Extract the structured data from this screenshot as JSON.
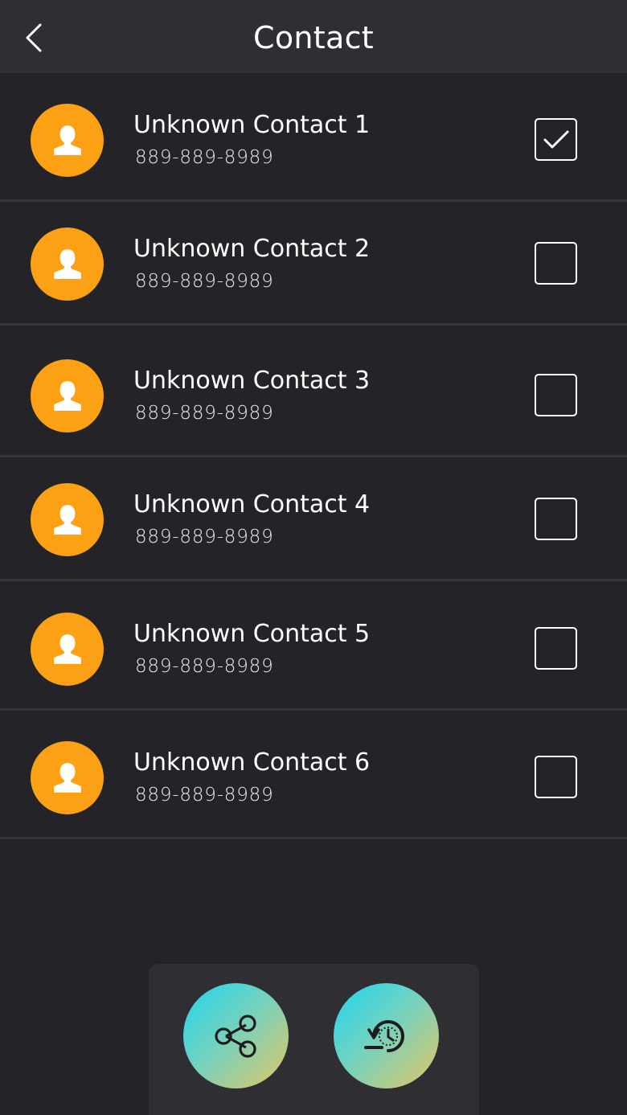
{
  "header": {
    "title": "Contact",
    "back_icon": "chevron-left-icon"
  },
  "contacts": [
    {
      "name": "Unknown Contact 1",
      "phone": "889-889-8989",
      "selected": true
    },
    {
      "name": "Unknown Contact 2",
      "phone": "889-889-8989",
      "selected": false
    },
    {
      "name": "Unknown Contact 3",
      "phone": "889-889-8989",
      "selected": false
    },
    {
      "name": "Unknown Contact 4",
      "phone": "889-889-8989",
      "selected": false
    },
    {
      "name": "Unknown Contact 5",
      "phone": "889-889-8989",
      "selected": false
    },
    {
      "name": "Unknown Contact 6",
      "phone": "889-889-8989",
      "selected": false
    }
  ],
  "actions": {
    "share_icon": "share-icon",
    "restore_icon": "restore-icon"
  },
  "colors": {
    "background": "#232328",
    "header": "#2f2f33",
    "avatar": "#fca014",
    "gradient_start": "#1ed6ef",
    "gradient_end": "#e2c664"
  }
}
